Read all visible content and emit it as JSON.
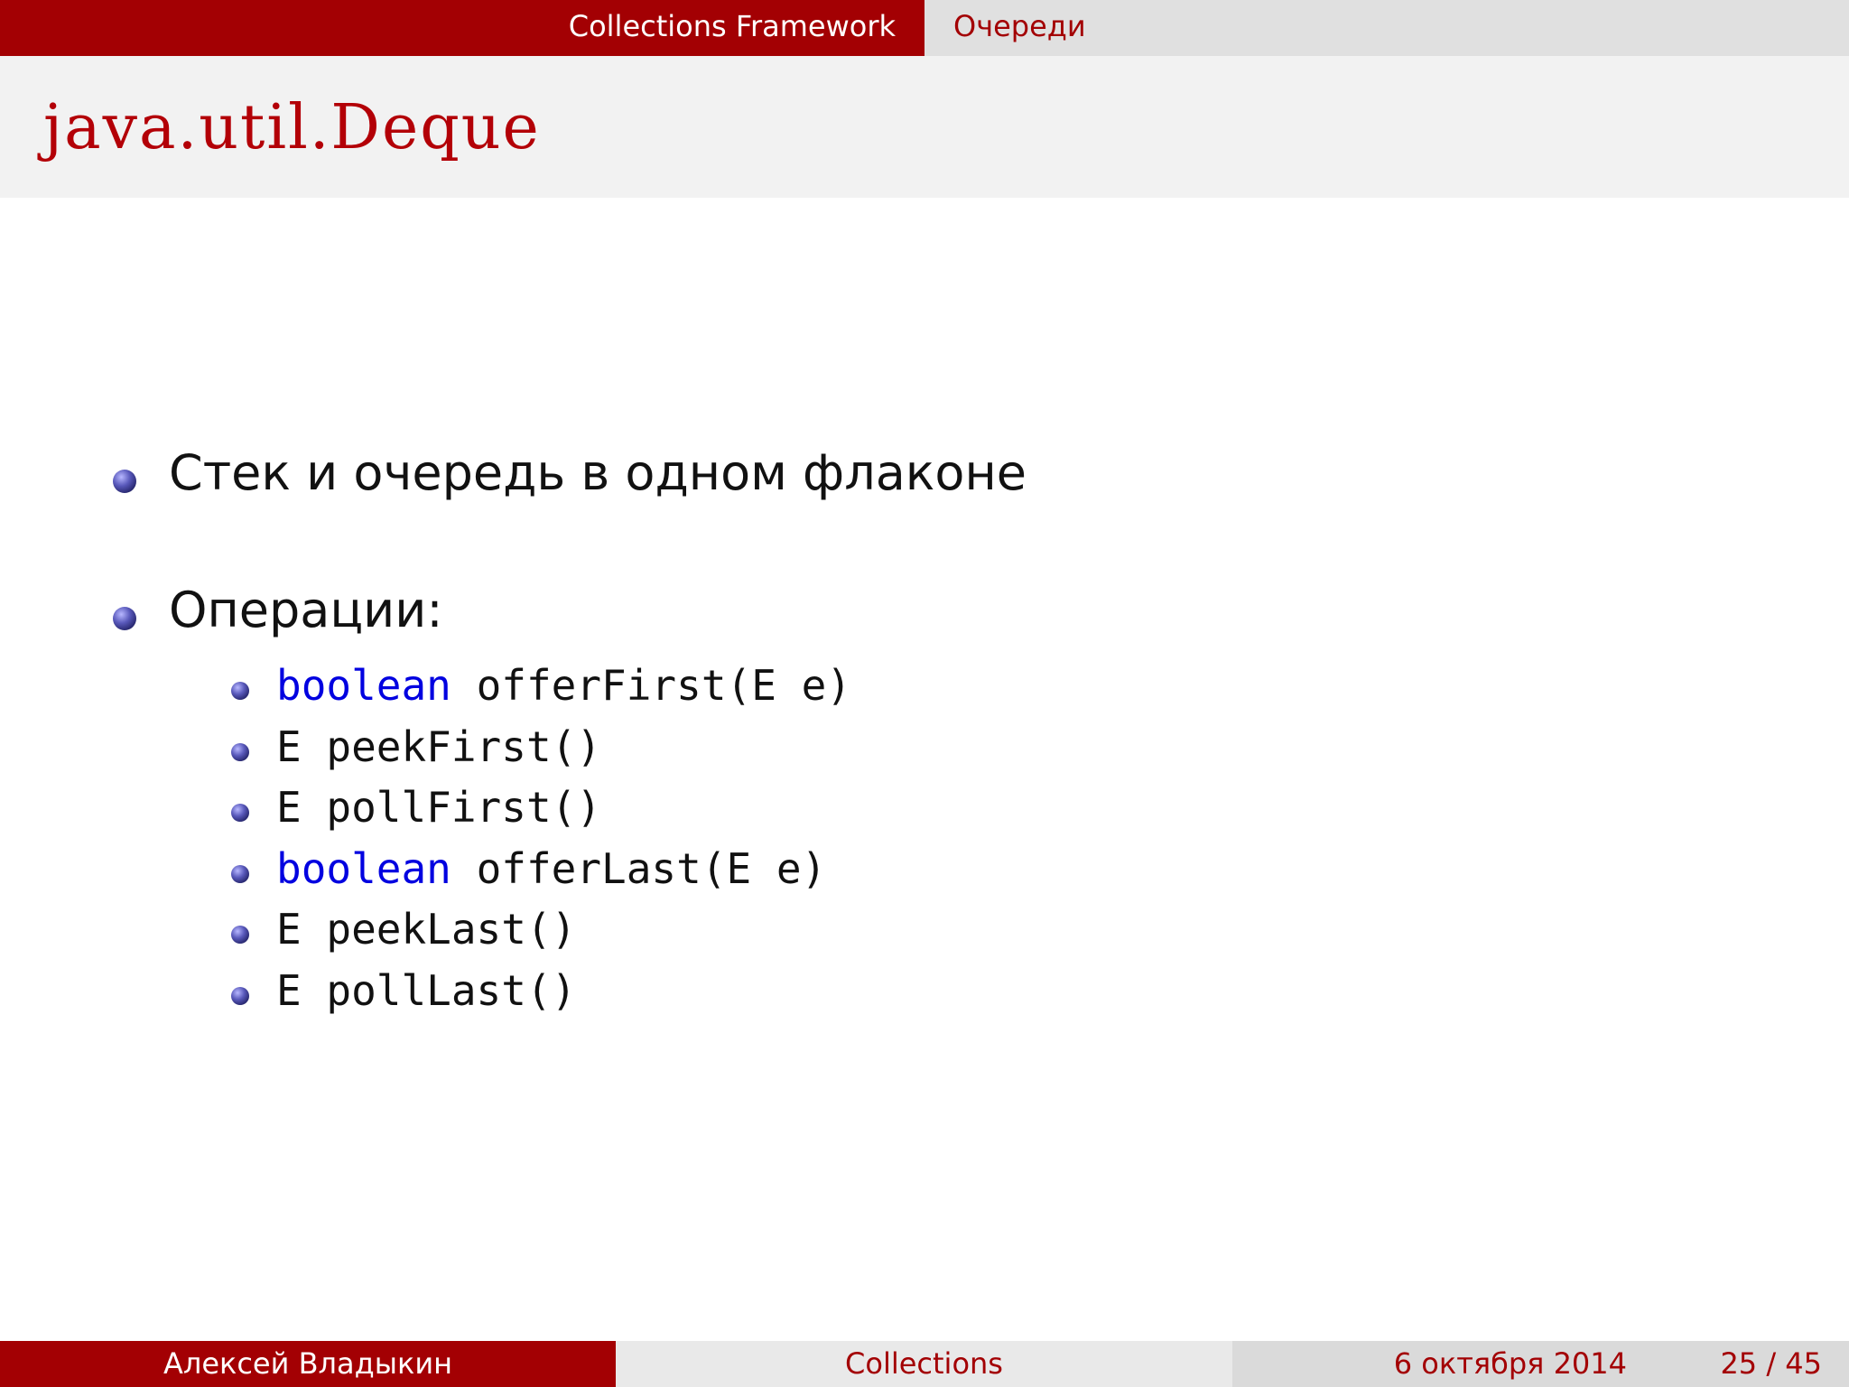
{
  "header": {
    "section": "Collections Framework",
    "subsection": "Очереди"
  },
  "frame": {
    "title": "java.util.Deque"
  },
  "content": {
    "items": [
      {
        "text": "Стек и очередь в одном флаконе"
      },
      {
        "text": "Операции:"
      }
    ],
    "operations": [
      {
        "keyword": "boolean",
        "text": " offerFirst(E e)"
      },
      {
        "keyword": "",
        "text": "E peekFirst()"
      },
      {
        "keyword": "",
        "text": "E pollFirst()"
      },
      {
        "keyword": "boolean",
        "text": " offerLast(E e)"
      },
      {
        "keyword": "",
        "text": "E peekLast()"
      },
      {
        "keyword": "",
        "text": "E pollLast()"
      }
    ]
  },
  "footer": {
    "author": "Алексей Владыкин",
    "title": "Collections",
    "date": "6 октября 2014",
    "page_current": "25",
    "page_separator": "/",
    "page_total": "45"
  },
  "colors": {
    "accent_dark_red": "#a30003",
    "title_red": "#b30007",
    "keyword_blue": "#0000e0",
    "bullet_blue": "#24246a"
  }
}
